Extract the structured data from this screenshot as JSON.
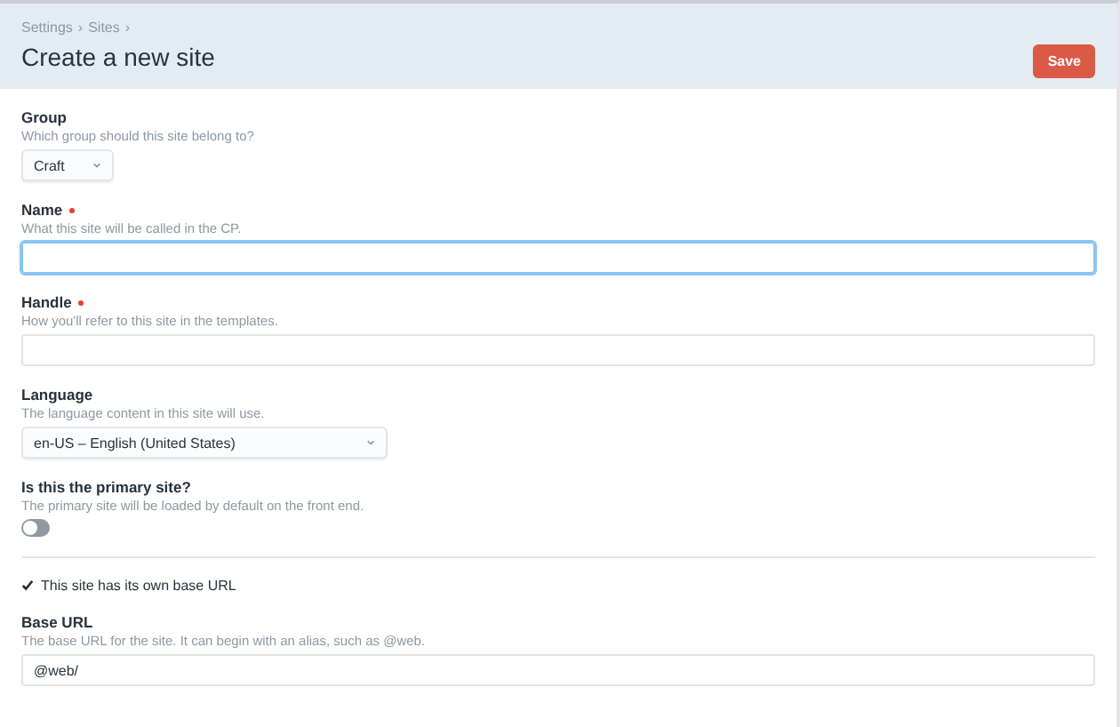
{
  "breadcrumbs": [
    {
      "label": "Settings",
      "separator": "›"
    },
    {
      "label": "Sites",
      "separator": "›"
    }
  ],
  "title": "Create a new site",
  "save_button": "Save",
  "fields": [
    {
      "kind": "select",
      "label": "Group",
      "required": false,
      "hint": "Which group should this site belong to?",
      "value": "Craft",
      "wide": false
    },
    {
      "kind": "text",
      "label": "Name",
      "required": true,
      "hint": "What this site will be called in the CP.",
      "focused": true
    },
    {
      "kind": "text",
      "label": "Handle",
      "required": true,
      "hint": "How you'll refer to this site in the templates.",
      "focused": false
    },
    {
      "kind": "select",
      "label": "Language",
      "required": false,
      "hint": "The language content in this site will use.",
      "value": "en-US – English (United States)",
      "wide": true
    },
    {
      "kind": "toggle",
      "label": "Is this the primary site?",
      "required": false,
      "hint": "The primary site will be loaded by default on the front end.",
      "on": false
    },
    {
      "kind": "divider"
    },
    {
      "kind": "checkbox",
      "label": "This site has its own base URL",
      "checked": true
    },
    {
      "kind": "text",
      "label": "Base URL",
      "required": false,
      "hint": "The base URL for the site. It can begin with an alias, such as @web.",
      "value": "@web/",
      "focused": false
    }
  ]
}
